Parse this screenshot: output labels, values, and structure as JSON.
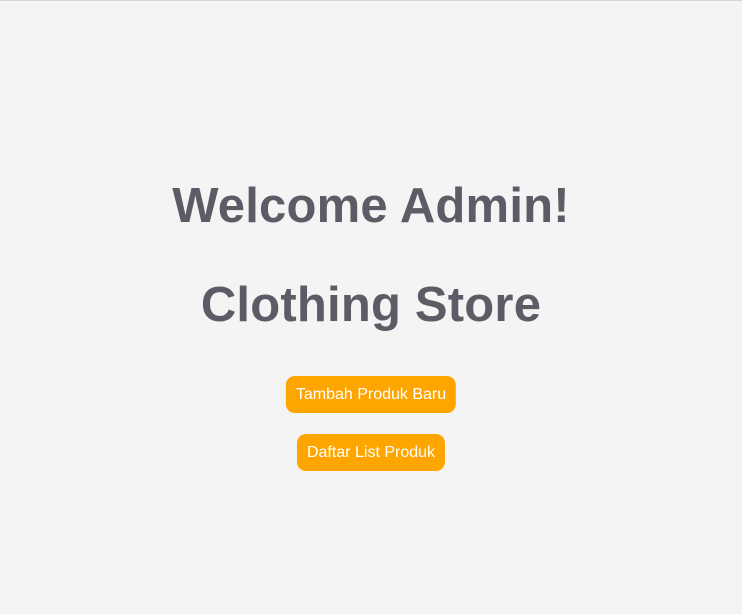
{
  "heading": {
    "welcome": "Welcome Admin!",
    "store_name": "Clothing Store"
  },
  "actions": {
    "add_product_label": "Tambah Produk Baru",
    "product_list_label": "Daftar List Produk"
  },
  "colors": {
    "background": "#f4f4f4",
    "heading": "#5b5c66",
    "button": "#ffa500",
    "button_text": "#ffffff"
  }
}
